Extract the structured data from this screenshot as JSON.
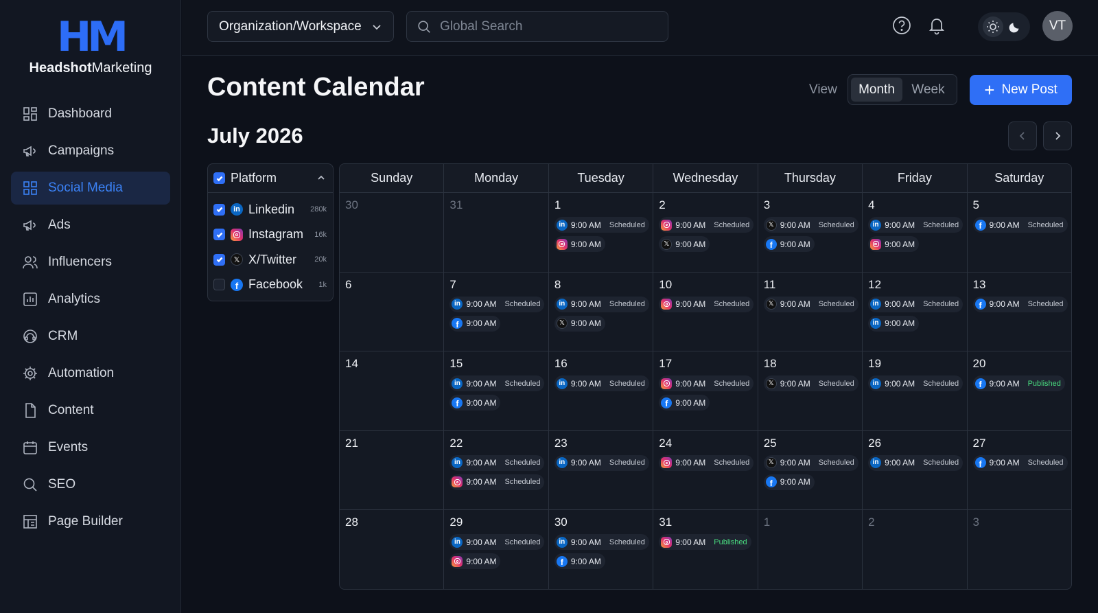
{
  "brand": {
    "mark": "HM",
    "name_bold": "Headshot",
    "name_rest": "Marketing",
    "accent": "#2f6ff6"
  },
  "sidebar": {
    "items": [
      {
        "label": "Dashboard",
        "icon": "dashboard-icon"
      },
      {
        "label": "Campaigns",
        "icon": "megaphone-icon"
      },
      {
        "label": "Social Media",
        "icon": "grid-icon",
        "active": true
      },
      {
        "label": "Ads",
        "icon": "megaphone-icon"
      },
      {
        "label": "Influencers",
        "icon": "users-icon"
      },
      {
        "label": "Analytics",
        "icon": "chart-icon"
      },
      {
        "label": "CRM",
        "icon": "headset-icon"
      },
      {
        "label": "Automation",
        "icon": "gear-icon"
      },
      {
        "label": "Content",
        "icon": "document-icon"
      },
      {
        "label": "Events",
        "icon": "calendar-icon"
      },
      {
        "label": "SEO",
        "icon": "search-icon"
      },
      {
        "label": "Page Builder",
        "icon": "layout-icon"
      }
    ]
  },
  "topbar": {
    "org_label": "Organization/Workspace",
    "search_placeholder": "Global Search",
    "avatar_initials": "VT"
  },
  "page": {
    "title": "Content Calendar",
    "view_label": "View",
    "view_options": [
      "Month",
      "Week"
    ],
    "selected_view": "Month",
    "new_post_label": "New Post",
    "month_label": "July 2026"
  },
  "filter": {
    "title": "Platform",
    "platforms": [
      {
        "key": "linkedin",
        "label": "Linkedin",
        "count": "280k",
        "checked": true
      },
      {
        "key": "instagram",
        "label": "Instagram",
        "count": "16k",
        "checked": true
      },
      {
        "key": "x",
        "label": "X/Twitter",
        "count": "20k",
        "checked": true
      },
      {
        "key": "facebook",
        "label": "Facebook",
        "count": "1k",
        "checked": false
      }
    ]
  },
  "calendar": {
    "weekdays": [
      "Sunday",
      "Monday",
      "Tuesday",
      "Wednesday",
      "Thursday",
      "Friday",
      "Saturday"
    ],
    "weeks": [
      [
        {
          "day": "30",
          "out": true,
          "posts": []
        },
        {
          "day": "31",
          "out": true,
          "posts": []
        },
        {
          "day": "1",
          "posts": [
            {
              "p": "linkedin",
              "time": "9:00 AM",
              "status": "Scheduled"
            },
            {
              "p": "instagram",
              "time": "9:00 AM",
              "status": ""
            }
          ]
        },
        {
          "day": "2",
          "posts": [
            {
              "p": "instagram",
              "time": "9:00 AM",
              "status": "Scheduled"
            },
            {
              "p": "x",
              "time": "9:00 AM",
              "status": ""
            }
          ]
        },
        {
          "day": "3",
          "posts": [
            {
              "p": "x",
              "time": "9:00 AM",
              "status": "Scheduled"
            },
            {
              "p": "facebook",
              "time": "9:00 AM",
              "status": ""
            }
          ]
        },
        {
          "day": "4",
          "posts": [
            {
              "p": "linkedin",
              "time": "9:00 AM",
              "status": "Scheduled"
            },
            {
              "p": "instagram",
              "time": "9:00 AM",
              "status": ""
            }
          ]
        },
        {
          "day": "5",
          "posts": [
            {
              "p": "facebook",
              "time": "9:00 AM",
              "status": "Scheduled"
            }
          ]
        }
      ],
      [
        {
          "day": "6",
          "posts": []
        },
        {
          "day": "7",
          "posts": [
            {
              "p": "linkedin",
              "time": "9:00 AM",
              "status": "Scheduled"
            },
            {
              "p": "facebook",
              "time": "9:00 AM",
              "status": ""
            }
          ]
        },
        {
          "day": "8",
          "posts": [
            {
              "p": "linkedin",
              "time": "9:00 AM",
              "status": "Scheduled"
            },
            {
              "p": "x",
              "time": "9:00 AM",
              "status": ""
            }
          ]
        },
        {
          "day": "10",
          "posts": [
            {
              "p": "instagram",
              "time": "9:00 AM",
              "status": "Scheduled"
            }
          ]
        },
        {
          "day": "11",
          "posts": [
            {
              "p": "x",
              "time": "9:00 AM",
              "status": "Scheduled"
            }
          ]
        },
        {
          "day": "12",
          "posts": [
            {
              "p": "linkedin",
              "time": "9:00 AM",
              "status": "Scheduled"
            },
            {
              "p": "linkedin",
              "time": "9:00 AM",
              "status": ""
            }
          ]
        },
        {
          "day": "13",
          "posts": [
            {
              "p": "facebook",
              "time": "9:00 AM",
              "status": "Scheduled"
            }
          ]
        }
      ],
      [
        {
          "day": "14",
          "posts": []
        },
        {
          "day": "15",
          "posts": [
            {
              "p": "linkedin",
              "time": "9:00 AM",
              "status": "Scheduled"
            },
            {
              "p": "facebook",
              "time": "9:00 AM",
              "status": ""
            }
          ]
        },
        {
          "day": "16",
          "posts": [
            {
              "p": "linkedin",
              "time": "9:00 AM",
              "status": "Scheduled"
            }
          ]
        },
        {
          "day": "17",
          "posts": [
            {
              "p": "instagram",
              "time": "9:00 AM",
              "status": "Scheduled"
            },
            {
              "p": "facebook",
              "time": "9:00 AM",
              "status": ""
            }
          ]
        },
        {
          "day": "18",
          "posts": [
            {
              "p": "x",
              "time": "9:00 AM",
              "status": "Scheduled"
            }
          ]
        },
        {
          "day": "19",
          "posts": [
            {
              "p": "linkedin",
              "time": "9:00 AM",
              "status": "Scheduled"
            }
          ]
        },
        {
          "day": "20",
          "posts": [
            {
              "p": "facebook",
              "time": "9:00 AM",
              "status": "Published"
            }
          ]
        }
      ],
      [
        {
          "day": "21",
          "posts": []
        },
        {
          "day": "22",
          "posts": [
            {
              "p": "linkedin",
              "time": "9:00 AM",
              "status": "Scheduled"
            },
            {
              "p": "instagram",
              "time": "9:00 AM",
              "status": "Scheduled"
            }
          ]
        },
        {
          "day": "23",
          "posts": [
            {
              "p": "linkedin",
              "time": "9:00 AM",
              "status": "Scheduled"
            }
          ]
        },
        {
          "day": "24",
          "posts": [
            {
              "p": "instagram",
              "time": "9:00 AM",
              "status": "Scheduled"
            }
          ]
        },
        {
          "day": "25",
          "posts": [
            {
              "p": "x",
              "time": "9:00 AM",
              "status": "Scheduled"
            },
            {
              "p": "facebook",
              "time": "9:00 AM",
              "status": ""
            }
          ]
        },
        {
          "day": "26",
          "posts": [
            {
              "p": "linkedin",
              "time": "9:00 AM",
              "status": "Scheduled"
            }
          ]
        },
        {
          "day": "27",
          "posts": [
            {
              "p": "facebook",
              "time": "9:00 AM",
              "status": "Scheduled"
            }
          ]
        }
      ],
      [
        {
          "day": "28",
          "posts": []
        },
        {
          "day": "29",
          "posts": [
            {
              "p": "linkedin",
              "time": "9:00 AM",
              "status": "Scheduled"
            },
            {
              "p": "instagram",
              "time": "9:00 AM",
              "status": ""
            }
          ]
        },
        {
          "day": "30",
          "posts": [
            {
              "p": "linkedin",
              "time": "9:00 AM",
              "status": "Scheduled"
            },
            {
              "p": "facebook",
              "time": "9:00 AM",
              "status": ""
            }
          ]
        },
        {
          "day": "31",
          "posts": [
            {
              "p": "instagram",
              "time": "9:00 AM",
              "status": "Published"
            }
          ]
        },
        {
          "day": "1",
          "out": true,
          "posts": []
        },
        {
          "day": "2",
          "out": true,
          "posts": []
        },
        {
          "day": "3",
          "out": true,
          "posts": []
        }
      ]
    ]
  },
  "colors": {
    "linkedin": "#0a66c2",
    "facebook": "#1877f2",
    "x": "#111111",
    "published": "#4ade80"
  }
}
